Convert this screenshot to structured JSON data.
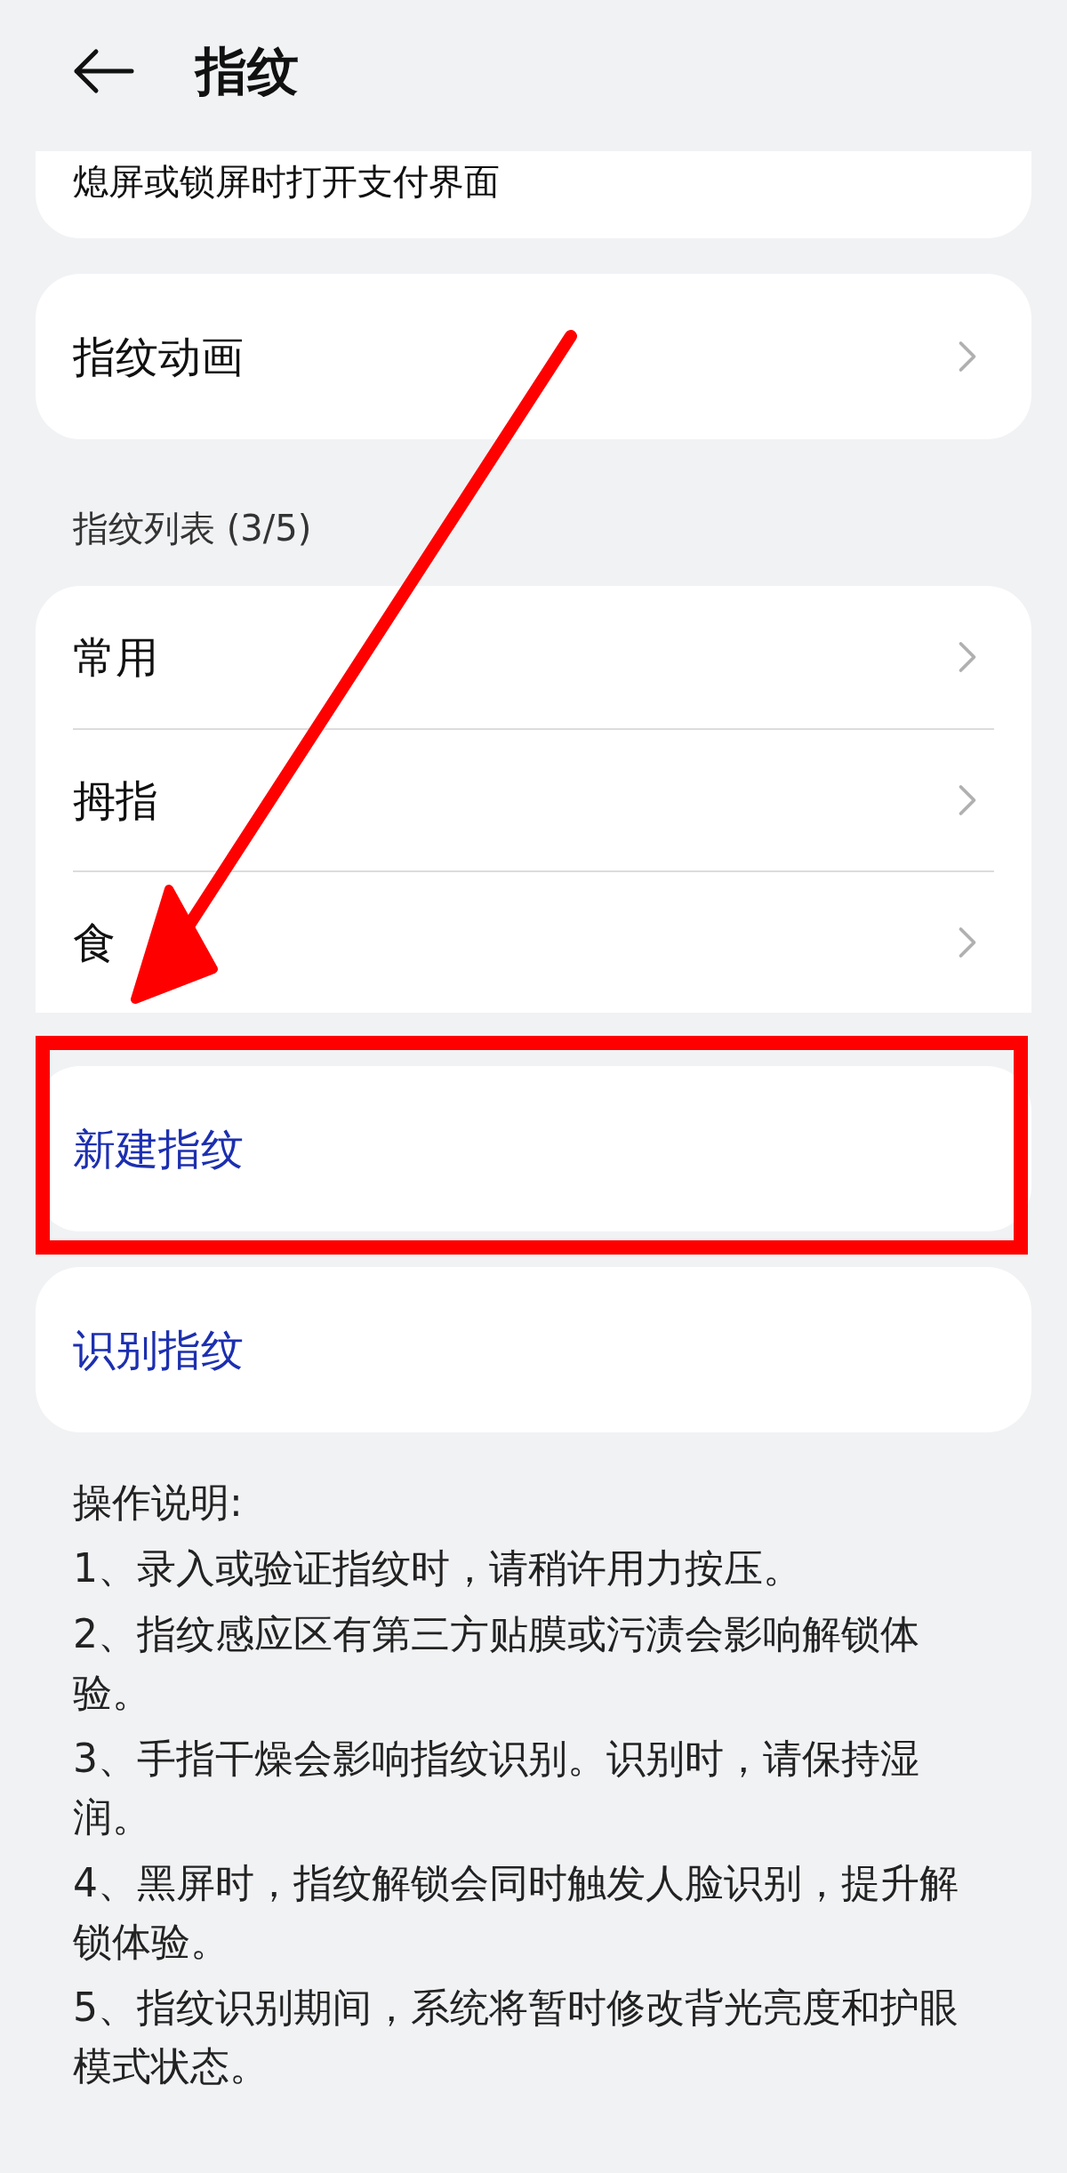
{
  "header": {
    "title": "指纹"
  },
  "top_card": {
    "label": "熄屏或锁屏时打开支付界面"
  },
  "animation_item": {
    "label": "指纹动画"
  },
  "fingerprint_list": {
    "heading": "指纹列表 (3/5)",
    "items": [
      {
        "label": "常用"
      },
      {
        "label": "拇指"
      },
      {
        "label": "食"
      }
    ]
  },
  "actions": [
    {
      "label": "新建指纹",
      "highlighted": true
    },
    {
      "label": "识别指纹",
      "highlighted": false
    }
  ],
  "instructions": {
    "heading": "操作说明:",
    "lines": [
      "1、录入或验证指纹时，请稍许用力按压。",
      "2、指纹感应区有第三方贴膜或污渍会影响解锁体验。",
      "3、手指干燥会影响指纹识别。识别时，请保持湿润。",
      "4、黑屏时，指纹解锁会同时触发人脸识别，提升解锁体验。",
      "5、指纹识别期间，系统将暂时修改背光亮度和护眼模式状态。"
    ]
  }
}
